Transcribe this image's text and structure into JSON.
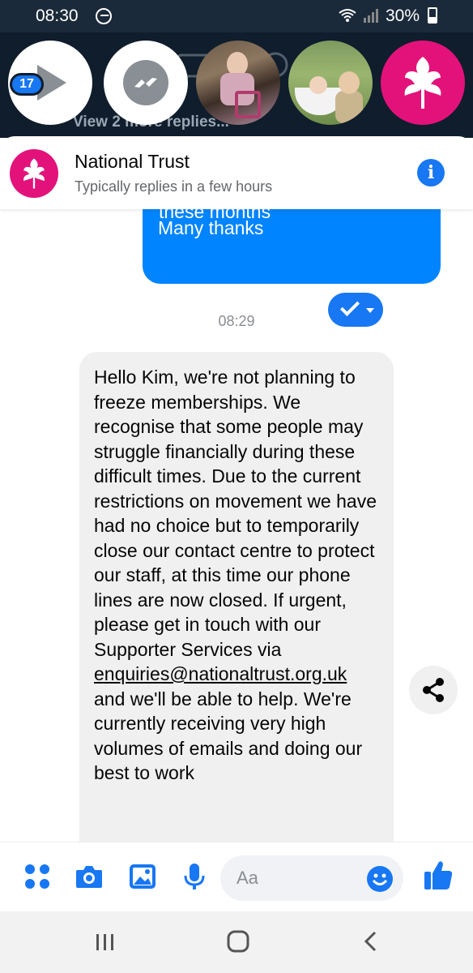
{
  "status_bar": {
    "time": "08:30",
    "battery": "30%"
  },
  "chat_heads": {
    "unread_badge": "17",
    "background_text": "View 2 more replies..."
  },
  "header": {
    "name": "National Trust",
    "status": "Typically replies in a few hours"
  },
  "messages": {
    "sent_cut_text": "these months",
    "sent_text": "Many thanks",
    "timestamp": "08:29",
    "received_before_link": "Hello Kim, we're not planning to freeze memberships. We recognise that some people may struggle financially during these difficult times. Due to the current restrictions on movement we have had no choice but to temporarily close our contact centre to protect our staff, at this time our phone lines are now closed. If urgent, please get in touch with our Supporter Services via ",
    "received_link": "enquiries@nationaltrust.org.uk",
    "received_after_link": " and we'll be able to help. We're currently receiving very high volumes of emails and doing our best to work"
  },
  "composer": {
    "placeholder": "Aa"
  },
  "colors": {
    "accent": "#1877f2",
    "sent_bubble": "#0084ff",
    "brand_pink": "#e3127a",
    "received_bubble": "#f0f0f0"
  }
}
